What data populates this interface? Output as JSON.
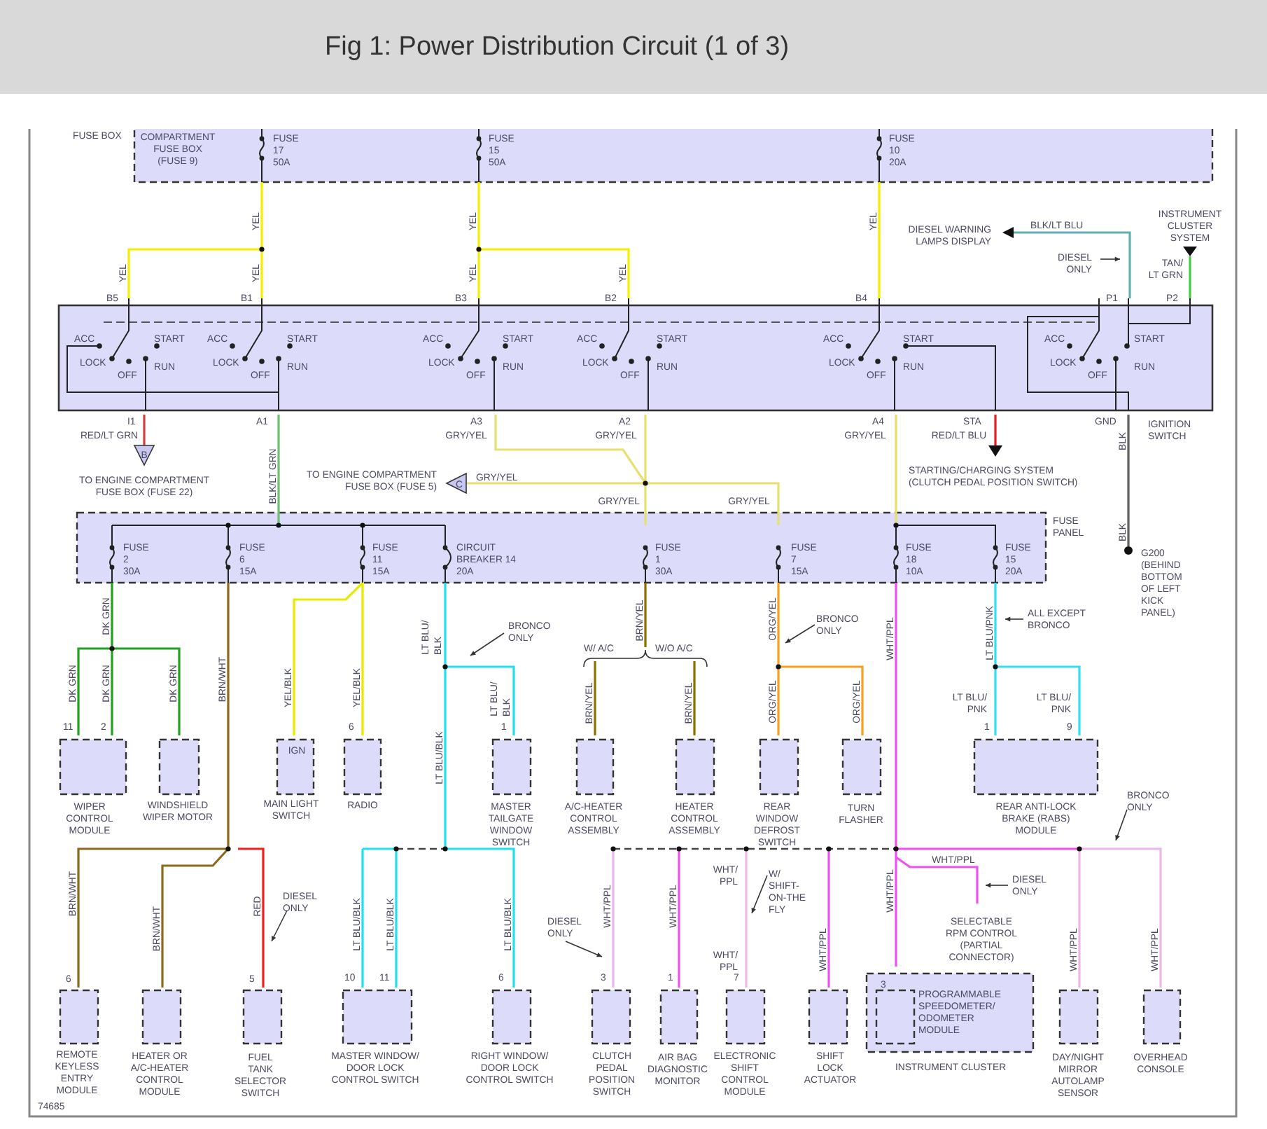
{
  "title": "Fig 1: Power Distribution Circuit (1 of 3)",
  "diagram": {
    "components": [
      {
        "kind": "dashed",
        "label": "COMPARTMENT\nFUSE BOX\n(FUSE 9)"
      },
      {
        "kind": "solid",
        "label": "IGNITION\nSWITCH"
      },
      {
        "kind": "dashed",
        "label": "FUSE\nPANEL"
      },
      {
        "kind": "dashed",
        "label": "WIPER\nCONTROL\nMODULE"
      },
      {
        "kind": "dashed",
        "label": "WINDSHIELD\nWIPER MOTOR"
      },
      {
        "kind": "dashed",
        "label": "MAIN LIGHT\nSWITCH"
      },
      {
        "kind": "dashed",
        "label": "RADIO"
      },
      {
        "kind": "dashed",
        "label": "MASTER\nTAILGATE\nWINDOW\nSWITCH"
      },
      {
        "kind": "dashed",
        "label": "A/C-HEATER\nCONTROL\nASSEMBLY"
      },
      {
        "kind": "dashed",
        "label": "HEATER\nCONTROL\nASSEMBLY"
      },
      {
        "kind": "dashed",
        "label": "REAR\nWINDOW\nDEFROST\nSWITCH"
      },
      {
        "kind": "dashed",
        "label": "TURN\nFLASHER"
      },
      {
        "kind": "dashed",
        "label": "REAR ANTI-LOCK\nBRAKE (RABS)\nMODULE"
      },
      {
        "kind": "dashed",
        "label": "REMOTE\nKEYLESS\nENTRY\nMODULE"
      },
      {
        "kind": "dashed",
        "label": "HEATER OR\nA/C-HEATER\nCONTROL\nMODULE"
      },
      {
        "kind": "dashed",
        "label": "FUEL\nTANK\nSELECTOR\nSWITCH"
      },
      {
        "kind": "dashed",
        "label": "MASTER WINDOW/\nDOOR LOCK\nCONTROL SWITCH"
      },
      {
        "kind": "dashed",
        "label": "RIGHT WINDOW/\nDOOR LOCK\nCONTROL SWITCH"
      },
      {
        "kind": "dashed",
        "label": "CLUTCH\nPEDAL\nPOSITION\nSWITCH"
      },
      {
        "kind": "dashed",
        "label": "AIR BAG\nDIAGNOSTIC\nMONITOR"
      },
      {
        "kind": "dashed",
        "label": "ELECTRONIC\nSHIFT\nCONTROL\nMODULE"
      },
      {
        "kind": "dashed",
        "label": "SHIFT\nLOCK\nACTUATOR"
      },
      {
        "kind": "dashed",
        "label": "PROGRAMMABLE\nSPEEDOMETER/\nODOMETER\nMODULE"
      },
      {
        "kind": "dashed",
        "label": "INSTRUMENT CLUSTER"
      },
      {
        "kind": "dashed",
        "label": "DAY/NIGHT\nMIRROR\nAUTOLAMP\nSENSOR"
      },
      {
        "kind": "dashed",
        "label": "OVERHEAD\nCONSOLE"
      }
    ],
    "fuses": [
      {
        "kind": "fuse",
        "label": "FUSE\n17\n50A"
      },
      {
        "kind": "fuse",
        "label": "FUSE\n15\n50A"
      },
      {
        "kind": "fuse",
        "label": "FUSE\n10\n20A"
      },
      {
        "kind": "fuse",
        "label": "FUSE\n2\n30A"
      },
      {
        "kind": "fuse",
        "label": "FUSE\n6\n15A"
      },
      {
        "kind": "fuse",
        "label": "FUSE\n11\n15A"
      },
      {
        "kind": "breaker",
        "label": "CIRCUIT\nBREAKER 14\n20A"
      },
      {
        "kind": "fuse",
        "label": "FUSE\n1\n30A"
      },
      {
        "kind": "fuse",
        "label": "FUSE\n7\n15A"
      },
      {
        "kind": "fuse",
        "label": "FUSE\n18\n10A"
      },
      {
        "kind": "fuse",
        "label": "FUSE\n15\n20A"
      }
    ],
    "switch_sets": [
      {
        "labels": [
          "ACC",
          "LOCK",
          "OFF",
          "START",
          "RUN"
        ]
      },
      {
        "labels": [
          "ACC",
          "LOCK",
          "OFF",
          "START",
          "RUN"
        ]
      },
      {
        "labels": [
          "ACC",
          "LOCK",
          "OFF",
          "START",
          "RUN"
        ]
      },
      {
        "labels": [
          "ACC",
          "LOCK",
          "OFF",
          "START",
          "RUN"
        ]
      },
      {
        "labels": [
          "ACC",
          "LOCK",
          "OFF",
          "START",
          "RUN"
        ]
      },
      {
        "labels": [
          "ACC",
          "LOCK",
          "OFF",
          "START",
          "RUN"
        ]
      }
    ],
    "pins": [
      "B5",
      "B1",
      "B3",
      "B2",
      "B4",
      "P1",
      "P2",
      "I1",
      "A1",
      "A3",
      "A2",
      "A4",
      "STA",
      "GND",
      "11",
      "2",
      "6",
      "1",
      "1",
      "9",
      "6",
      "5",
      "10",
      "11",
      "6",
      "3",
      "1",
      "7",
      "3"
    ],
    "wires": [
      {
        "color": "#f0f000",
        "labels": [
          "YEL",
          "YEL",
          "YEL"
        ]
      },
      {
        "color": "#f0f000",
        "labels": [
          "YEL",
          "YEL",
          "YEL"
        ]
      },
      {
        "color": "#f0f000",
        "labels": [
          "YEL"
        ]
      },
      {
        "color": "#60b0b0",
        "labels": [
          "BLK/LT BLU"
        ]
      },
      {
        "color": "#44cc44",
        "labels": [
          "TAN/\nLT GRN"
        ]
      },
      {
        "color": "#d04040",
        "labels": [
          "RED/LT GRN"
        ]
      },
      {
        "color": "#70c070",
        "labels": [
          "BLK/LT GRN"
        ]
      },
      {
        "color": "#e6e070",
        "labels": [
          "GRY/YEL",
          "GRY/YEL",
          "GRY/YEL",
          "GRY/YEL",
          "GRY/YEL"
        ]
      },
      {
        "color": "#e6e070",
        "labels": [
          "GRY/YEL"
        ]
      },
      {
        "color": "#e02020",
        "labels": [
          "RED/LT BLU"
        ]
      },
      {
        "color": "#606060",
        "labels": [
          "BLK",
          "BLK"
        ]
      },
      {
        "color": "#22a022",
        "labels": [
          "DK GRN",
          "DK GRN",
          "DK GRN",
          "DK GRN"
        ]
      },
      {
        "color": "#8a6a1c",
        "labels": [
          "BRN/WHT",
          "BRN/WHT",
          "BRN/WHT"
        ]
      },
      {
        "color": "#e8e800",
        "labels": [
          "YEL/BLK",
          "YEL/BLK"
        ]
      },
      {
        "color": "#20e0f0",
        "labels": [
          "LT BLU/",
          "BLK",
          "LT BLU/",
          "BLK",
          "LT BLU/BLK",
          "LT BLU/BLK",
          "LT BLU/BLK",
          "LT BLU/BLK"
        ]
      },
      {
        "color": "#8a7000",
        "labels": [
          "BRN/YEL",
          "BRN/YEL",
          "BRN/YEL"
        ]
      },
      {
        "color": "#f5a020",
        "labels": [
          "ORG/YEL",
          "ORG/YEL",
          "ORG/YEL"
        ]
      },
      {
        "color": "#f050f0",
        "labels": [
          "WHT/PPL",
          "WHT/PPL",
          "WHT/PPL",
          "WHT/PPL",
          "WHT/PPL"
        ]
      },
      {
        "color": "#e8b8e8",
        "labels": [
          "WHT/PPL",
          "WHT/\nPPL",
          "WHT/\nPPL",
          "WHT/PPL",
          "WHT/PPL"
        ]
      },
      {
        "color": "#ee2020",
        "labels": [
          "RED"
        ]
      },
      {
        "color": "#30e0f0",
        "labels": [
          "LT BLU/PNK",
          "LT BLU/\nPNK",
          "LT BLU/\nPNK"
        ]
      }
    ],
    "connectors": [
      {
        "letter": "B"
      },
      {
        "letter": "C"
      }
    ],
    "notes": [
      "FUSE BOX",
      "TO ENGINE COMPARTMENT\nFUSE BOX (FUSE 22)",
      "TO ENGINE COMPARTMENT\nFUSE BOX (FUSE 5)",
      "STARTING/CHARGING SYSTEM\n(CLUTCH PEDAL POSITION SWITCH)",
      "G200\n(BEHIND\nBOTTOM\nOF LEFT\nKICK\nPANEL)",
      "DIESEL WARNING\nLAMPS DISPLAY",
      "DIESEL\nONLY",
      "INSTRUMENT\nCLUSTER\nSYSTEM",
      "BRONCO\nONLY",
      "W/ A/C",
      "W/O A/C",
      "BRONCO\nONLY",
      "ALL EXCEPT\nBRONCO",
      "BRONCO\nONLY",
      "IGN",
      "DIESEL\nONLY",
      "DIESEL\nONLY",
      "W/\nSHIFT-\nON-THE\nFLY",
      "DIESEL\nONLY",
      "SELECTABLE\nRPM CONTROL\n(PARTIAL\nCONNECTOR)",
      "74685"
    ]
  }
}
